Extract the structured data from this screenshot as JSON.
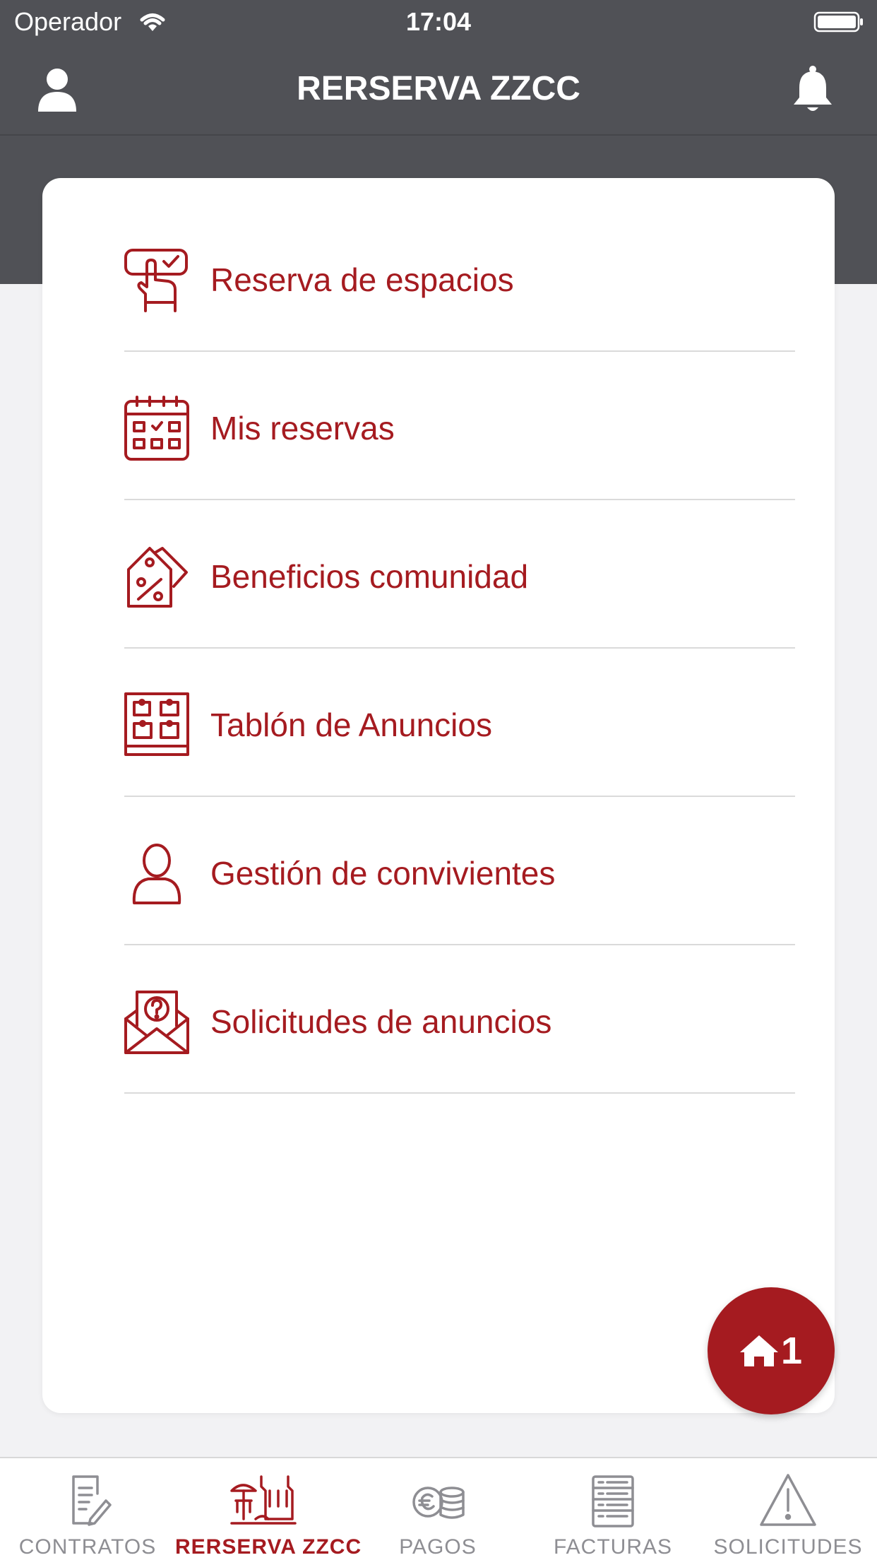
{
  "status_bar": {
    "carrier": "Operador",
    "time": "17:04"
  },
  "nav": {
    "title": "RERSERVA ZZCC",
    "left_icon": "user-icon",
    "right_icon": "bell-icon"
  },
  "menu": {
    "items": [
      {
        "label": "Reserva de espacios",
        "icon": "hand-select-icon"
      },
      {
        "label": "Mis reservas",
        "icon": "calendar-icon"
      },
      {
        "label": "Beneficios comunidad",
        "icon": "discount-tag-icon"
      },
      {
        "label": "Tablón de Anuncios",
        "icon": "notice-board-icon"
      },
      {
        "label": "Gestión de convivientes",
        "icon": "person-icon"
      },
      {
        "label": "Solicitudes de anuncios",
        "icon": "envelope-question-icon"
      }
    ]
  },
  "fab": {
    "count": "1",
    "icon": "home-icon"
  },
  "tabs": [
    {
      "label": "CONTRATOS",
      "icon": "contract-icon",
      "active": false
    },
    {
      "label": "RERSERVA ZZCC",
      "icon": "reservation-icon",
      "active": true
    },
    {
      "label": "PAGOS",
      "icon": "coins-icon",
      "active": false
    },
    {
      "label": "FACTURAS",
      "icon": "invoice-icon",
      "active": false
    },
    {
      "label": "SOLICITUDES",
      "icon": "warning-icon",
      "active": false
    }
  ],
  "colors": {
    "accent": "#a51b20",
    "header": "#505156",
    "inactive": "#8e8e93",
    "background": "#f2f2f4"
  }
}
